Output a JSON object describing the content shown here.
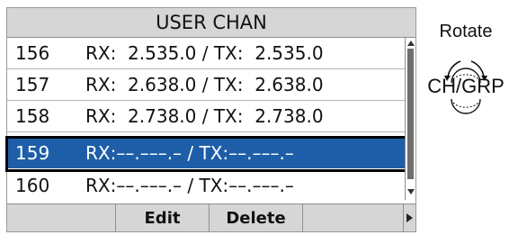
{
  "screen": {
    "title": "USER CHAN",
    "channels": [
      {
        "number": "156",
        "freq": "RX:  2.535.0 / TX:  2.535.0"
      },
      {
        "number": "157",
        "freq": "RX:  2.638.0 / TX:  2.638.0"
      },
      {
        "number": "158",
        "freq": "RX:  2.738.0 / TX:  2.738.0"
      },
      {
        "number": "159",
        "freq": "RX:––.–––.– / TX:––.–––.–"
      },
      {
        "number": "160",
        "freq": "RX:––.–––.– / TX:––.–––.–"
      }
    ],
    "selected_index": 3,
    "softkeys": {
      "key1": "",
      "key2": "Edit",
      "key3": "Delete",
      "key4": ""
    }
  },
  "side": {
    "rotate_label": "Rotate",
    "knob_label": "CH/GRP",
    "knob_icon": "rotary-knob-icon"
  },
  "colors": {
    "selected_bg": "#1e5ea8",
    "bar_bg": "#d6d6d6"
  }
}
